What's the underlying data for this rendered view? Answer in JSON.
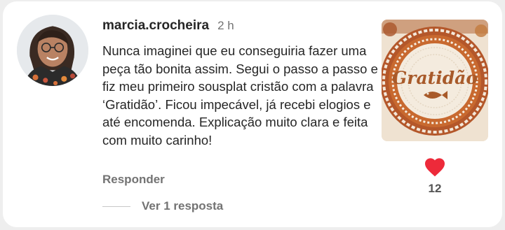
{
  "comment": {
    "username": "marcia.crocheira",
    "time": "2 h",
    "text": "Nunca imaginei que eu conseguiria fazer uma peça tão bonita assim. Segui o passo a passo e fiz meu primeiro sousplat cristão com a palavra ‘Gratidão’. Ficou impecável, já recebi elogios e até encomenda. Explicação muito clara e feita com muito carinho!",
    "reply_label": "Responder",
    "view_replies_label": "Ver 1 resposta",
    "like_count": "12"
  },
  "media": {
    "image_text": "Gratidão"
  },
  "icons": {
    "like": "heart-icon"
  },
  "colors": {
    "like": "#ed2a3a",
    "secondary_text": "#737373",
    "primary_text": "#262626"
  }
}
